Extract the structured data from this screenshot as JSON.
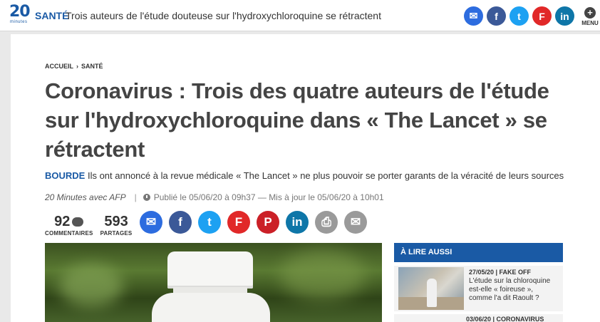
{
  "topbar": {
    "logo_number": "20",
    "logo_sub": "minutes",
    "section": "SANTÉ",
    "title": "Trois auteurs de l'étude douteuse sur l'hydroxychloroquine se rétractent",
    "share_icons": [
      {
        "name": "messenger-icon",
        "glyph": "✉",
        "color": "#2d6cdf"
      },
      {
        "name": "facebook-icon",
        "glyph": "f",
        "color": "#3b5998"
      },
      {
        "name": "twitter-icon",
        "glyph": "t",
        "color": "#1da1f2"
      },
      {
        "name": "flipboard-icon",
        "glyph": "F",
        "color": "#e12828"
      },
      {
        "name": "linkedin-icon",
        "glyph": "in",
        "color": "#0e76a8"
      }
    ],
    "menu_label": "MENU",
    "menu_glyph": "+"
  },
  "breadcrumb": {
    "home": "ACCUEIL",
    "separator": "›",
    "section": "SANTÉ"
  },
  "headline": "Coronavirus : Trois des quatre auteurs de l'étude sur l'hydroxychloroquine dans « The Lancet » se rétractent",
  "lede": {
    "tag": "BOURDE",
    "text": " Ils ont annoncé à la revue médicale « The Lancet » ne plus pouvoir se porter garants de la véracité de leurs sources"
  },
  "meta": {
    "author": "20 Minutes avec AFP",
    "separator": "|",
    "published": "Publié le 05/06/20 à 09h37 — Mis à jour le 05/06/20 à 10h01"
  },
  "counts": {
    "comments_value": "92",
    "comments_label": "COMMENTAIRES",
    "shares_value": "593",
    "shares_label": "PARTAGES"
  },
  "share_row": [
    {
      "name": "messenger-share-button",
      "glyph": "✉",
      "color": "#2d6cdf"
    },
    {
      "name": "facebook-share-button",
      "glyph": "f",
      "color": "#3b5998"
    },
    {
      "name": "twitter-share-button",
      "glyph": "t",
      "color": "#1da1f2"
    },
    {
      "name": "flipboard-share-button",
      "glyph": "F",
      "color": "#e12828"
    },
    {
      "name": "pinterest-share-button",
      "glyph": "P",
      "color": "#cb2027"
    },
    {
      "name": "linkedin-share-button",
      "glyph": "in",
      "color": "#0e76a8"
    },
    {
      "name": "print-button",
      "glyph": "⎙",
      "color": "#9a9a9a"
    },
    {
      "name": "email-share-button",
      "glyph": "✉",
      "color": "#9a9a9a"
    }
  ],
  "aside": {
    "heading": "À LIRE AUSSI",
    "items": [
      {
        "meta": "27/05/20 | FAKE OFF",
        "title": "L'étude sur la chloroquine est-elle « foireuse », comme l'a dit Raoult ?"
      },
      {
        "meta": "03/06/20 | CORONAVIRUS"
      }
    ]
  },
  "colors": {
    "brand": "#1a5aa5",
    "headline": "#444444"
  }
}
